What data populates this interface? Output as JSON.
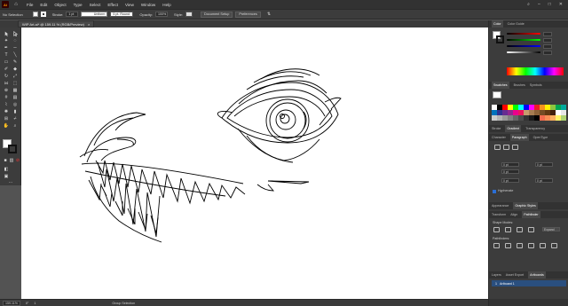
{
  "app": {
    "logo": "Ai",
    "home_icon": "home-icon"
  },
  "menu": [
    "File",
    "Edit",
    "Object",
    "Type",
    "Select",
    "Effect",
    "View",
    "Window",
    "Help"
  ],
  "controlbar": {
    "selection": "No Selection",
    "stroke_label": "Stroke:",
    "stroke_weight": "1 pt",
    "profile": "Uniform",
    "brush": "5 pt. Round",
    "opacity_label": "Opacity:",
    "opacity": "100%",
    "style_label": "Style:",
    "doc_setup": "Document Setup",
    "preferences": "Preferences"
  },
  "document": {
    "tab_title": "WIP Art.ai* @ 159.11 % (RGB/Preview)",
    "close": "×"
  },
  "statusbar": {
    "zoom": "159.11%",
    "rotation": "0°",
    "page": "1",
    "selection_mode": "Group Selection"
  },
  "panels": {
    "color_tabs": [
      "Color",
      "Color Guide"
    ],
    "swatch_tabs": [
      "Swatches",
      "Brushes",
      "Symbols"
    ],
    "stroke_tabs": [
      "Stroke",
      "Gradient",
      "Transparency"
    ],
    "char_tabs": [
      "Character",
      "Paragraph",
      "OpenType"
    ],
    "hyphenate": "Hyphenate",
    "styles_tabs": [
      "Appearance",
      "Graphic Styles"
    ],
    "transform_tabs": [
      "Transform",
      "Align",
      "Pathfinder"
    ],
    "shape_modes": "Shape Modes:",
    "pathfinders": "Pathfinders:",
    "expand": "Expand",
    "layers_tabs": [
      "Layers",
      "Asset Export",
      "Artboards"
    ],
    "artboard_index": "1",
    "artboard_name": "Artboard 1",
    "para_values": [
      "0 pt",
      "0 pt",
      "0 pt",
      "0 pt",
      "0 pt"
    ]
  },
  "colors": {
    "accent_blue": "#2a4f7f",
    "swatches": [
      "#ffffff",
      "#000000",
      "#ff0000",
      "#ffff00",
      "#00ff00",
      "#00ffff",
      "#0000ff",
      "#ff00ff",
      "#ed1c24",
      "#f7941d",
      "#fff200",
      "#8dc63f",
      "#00a651",
      "#00a99d",
      "#0072bc",
      "#2e3192",
      "#662d91",
      "#92278f",
      "#ec008c",
      "#ed145b",
      "#c69c6d",
      "#a67c52",
      "#8c6239",
      "#754c24",
      "#603913",
      "#42210b",
      "#ffffff",
      "#e6e6e6",
      "#cccccc",
      "#b3b3b3",
      "#999999",
      "#808080",
      "#666666",
      "#4d4d4d",
      "#333333",
      "#1a1a1a",
      "#000000",
      "#f26c4f",
      "#f68e55",
      "#fbaf5c",
      "#fff467",
      "#acd372"
    ]
  }
}
